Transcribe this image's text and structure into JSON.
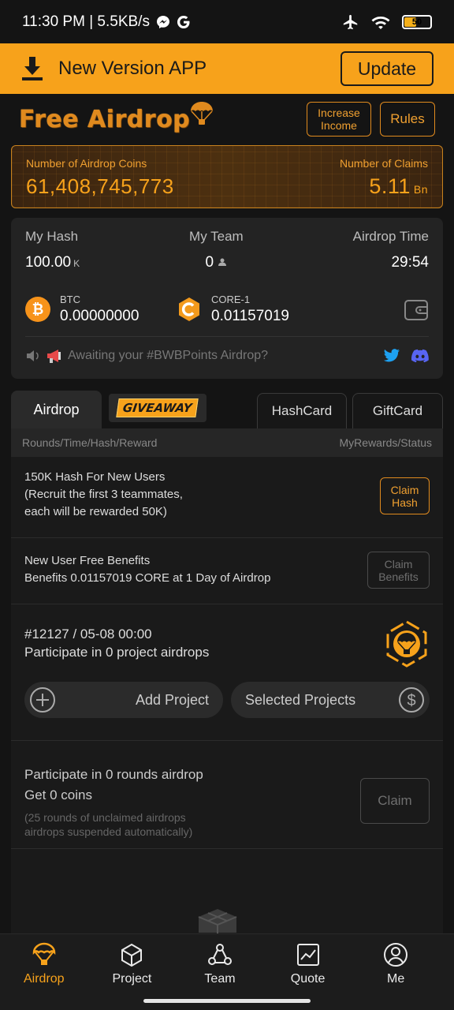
{
  "status_bar": {
    "time_speed": "11:30 PM | 5.5KB/s",
    "battery": "50"
  },
  "update_bar": {
    "title": "New Version APP",
    "button": "Update"
  },
  "header": {
    "logo_text": "Free Airdrop",
    "increase_income": "Increase Income",
    "rules": "Rules"
  },
  "coins_card": {
    "airdrop_coins_label": "Number of Airdrop Coins",
    "airdrop_coins_value": "61,408,745,773",
    "claims_label": "Number of Claims",
    "claims_value": "5.11",
    "claims_unit": "Bn"
  },
  "stats": {
    "my_hash_label": "My Hash",
    "my_hash_value": "100.00",
    "my_hash_unit": "K",
    "my_team_label": "My Team",
    "my_team_value": "0",
    "airdrop_time_label": "Airdrop Time",
    "airdrop_time_value": "29:54"
  },
  "assets": [
    {
      "name": "BTC",
      "value": "0.00000000",
      "icon": "bitcoin-icon",
      "color": "#f7931a"
    },
    {
      "name": "CORE-1",
      "value": "0.01157019",
      "icon": "core-icon",
      "color": "#f39a1c"
    }
  ],
  "notice": {
    "text": "Awaiting your #BWBPoints Airdrop?"
  },
  "tabs": {
    "airdrop": "Airdrop",
    "giveaway": "GIVEAWAY",
    "hashcard": "HashCard",
    "giftcard": "GiftCard"
  },
  "list_header": {
    "left": "Rounds/Time/Hash/Reward",
    "right": "MyRewards/Status"
  },
  "items": {
    "new_user_hash": {
      "line1": "150K Hash For New Users",
      "line2": "(Recruit the first 3 teammates,",
      "line3": "each will be rewarded 50K)",
      "button": "Claim Hash"
    },
    "new_user_benefits": {
      "line1": "New User Free Benefits",
      "line2": "Benefits 0.01157019 CORE at 1 Day of Airdrop",
      "button": "Claim Benefits"
    },
    "round": {
      "title": "#12127 / 05-08 00:00",
      "subtitle": "Participate in 0 project airdrops",
      "add_project": "Add Project",
      "selected_projects": "Selected Projects"
    },
    "rounds_claim": {
      "line1": "Participate in 0 rounds airdrop",
      "line2": "Get 0 coins",
      "note1": "(25 rounds of unclaimed airdrops",
      "note2": "airdrops suspended automatically)",
      "button": "Claim"
    }
  },
  "bottom_nav": [
    {
      "label": "Airdrop",
      "icon": "airdrop-icon",
      "active": true
    },
    {
      "label": "Project",
      "icon": "cube-icon",
      "active": false
    },
    {
      "label": "Team",
      "icon": "team-icon",
      "active": false
    },
    {
      "label": "Quote",
      "icon": "chart-icon",
      "active": false
    },
    {
      "label": "Me",
      "icon": "user-icon",
      "active": false
    }
  ],
  "colors": {
    "accent": "#f7a21b",
    "background": "#141414",
    "card": "#232323"
  }
}
